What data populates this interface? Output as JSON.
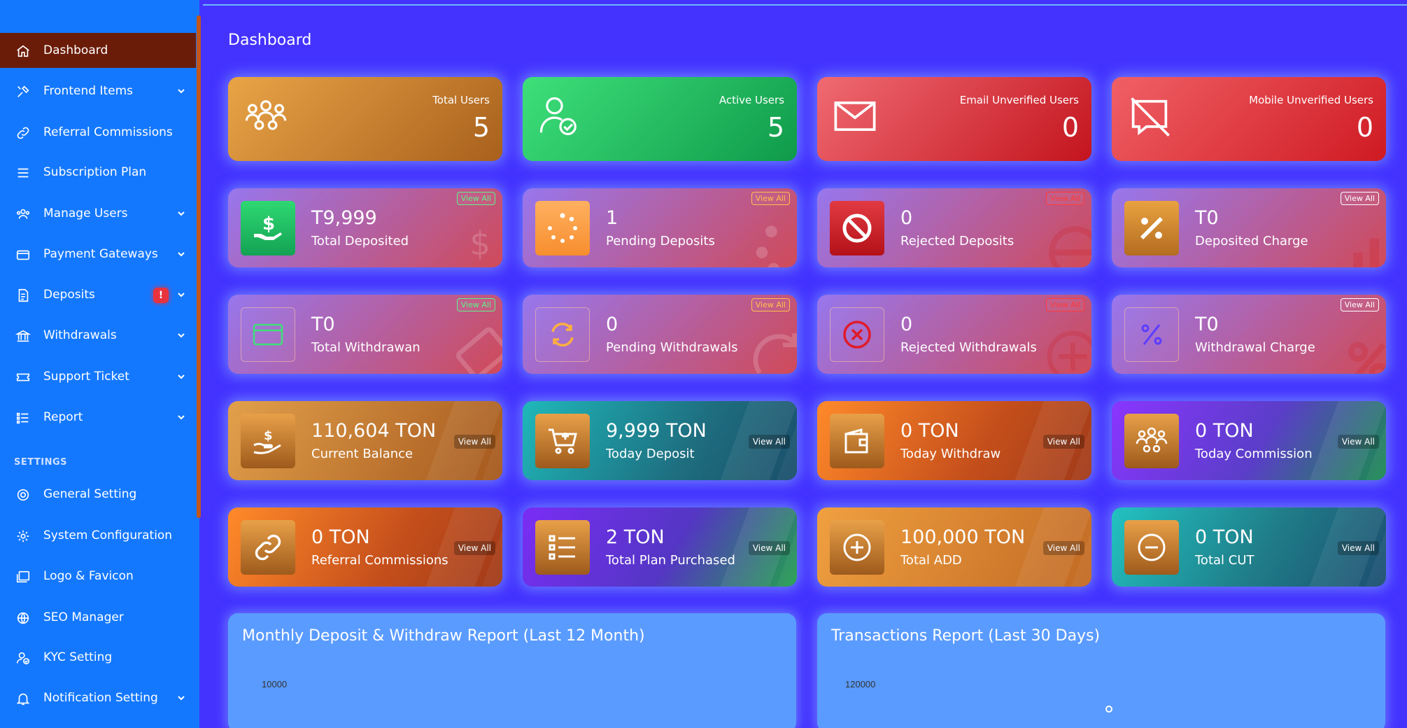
{
  "sidebar": {
    "items": [
      {
        "label": "Dashboard",
        "icon": "home-icon",
        "active": true,
        "chevron": false
      },
      {
        "label": "Frontend Items",
        "icon": "tools-icon",
        "chevron": true
      },
      {
        "label": "Referral Commissions",
        "icon": "link-icon",
        "chevron": false
      },
      {
        "label": "Subscription Plan",
        "icon": "menu-icon",
        "chevron": false
      },
      {
        "label": "Manage Users",
        "icon": "users-icon",
        "chevron": true
      },
      {
        "label": "Payment Gateways",
        "icon": "card-icon",
        "chevron": true
      },
      {
        "label": "Deposits",
        "icon": "receipt-icon",
        "chevron": true,
        "badge": "!"
      },
      {
        "label": "Withdrawals",
        "icon": "bank-icon",
        "chevron": true
      },
      {
        "label": "Support Ticket",
        "icon": "ticket-icon",
        "chevron": true
      },
      {
        "label": "Report",
        "icon": "list-icon",
        "chevron": true
      }
    ],
    "settings_header": "SETTINGS",
    "settings_items": [
      {
        "label": "General Setting",
        "icon": "lifebuoy-icon",
        "chevron": false
      },
      {
        "label": "System Configuration",
        "icon": "gear-icon",
        "chevron": false
      },
      {
        "label": "Logo & Favicon",
        "icon": "images-icon",
        "chevron": false
      },
      {
        "label": "SEO Manager",
        "icon": "globe-icon",
        "chevron": false
      },
      {
        "label": "KYC Setting",
        "icon": "user-check-icon",
        "chevron": false
      },
      {
        "label": "Notification Setting",
        "icon": "bell-icon",
        "chevron": true
      }
    ]
  },
  "page_title": "Dashboard",
  "top_cards": [
    {
      "label": "Total Users",
      "value": "5",
      "icon": "users-group-icon"
    },
    {
      "label": "Active Users",
      "value": "5",
      "icon": "user-check-icon"
    },
    {
      "label": "Email Unverified Users",
      "value": "0",
      "icon": "envelope-icon"
    },
    {
      "label": "Mobile Unverified Users",
      "value": "0",
      "icon": "message-slash-icon"
    }
  ],
  "deposit_cards": [
    {
      "value": "T9,999",
      "label": "Total Deposited",
      "link": "View All",
      "icon": "hand-dollar-icon"
    },
    {
      "value": "1",
      "label": "Pending Deposits",
      "link": "View All",
      "icon": "spinner-icon"
    },
    {
      "value": "0",
      "label": "Rejected Deposits",
      "link": "View All",
      "icon": "ban-icon"
    },
    {
      "value": "T0",
      "label": "Deposited Charge",
      "link": "View All",
      "icon": "percent-icon"
    }
  ],
  "withdraw_cards": [
    {
      "value": "T0",
      "label": "Total Withdrawan",
      "link": "View All",
      "icon": "credit-card-icon"
    },
    {
      "value": "0",
      "label": "Pending Withdrawals",
      "link": "View All",
      "icon": "sync-icon"
    },
    {
      "value": "0",
      "label": "Rejected Withdrawals",
      "link": "View All",
      "icon": "x-circle-icon"
    },
    {
      "value": "T0",
      "label": "Withdrawal Charge",
      "link": "View All",
      "icon": "percent-icon"
    }
  ],
  "balance_cards": [
    {
      "value": "110,604 TON",
      "label": "Current Balance",
      "link": "View All",
      "icon": "hand-coin-icon"
    },
    {
      "value": "9,999 TON",
      "label": "Today Deposit",
      "link": "View All",
      "icon": "cart-plus-icon"
    },
    {
      "value": "0 TON",
      "label": "Today Withdraw",
      "link": "View All",
      "icon": "wallet-icon"
    },
    {
      "value": "0 TON",
      "label": "Today Commission",
      "link": "View All",
      "icon": "users-group-icon"
    }
  ],
  "total_cards": [
    {
      "value": "0 TON",
      "label": "Referral Commissions",
      "link": "View All",
      "icon": "link-icon"
    },
    {
      "value": "2 TON",
      "label": "Total Plan Purchased",
      "link": "View All",
      "icon": "list-check-icon"
    },
    {
      "value": "100,000 TON",
      "label": "Total ADD",
      "link": "View All",
      "icon": "plus-circle-icon"
    },
    {
      "value": "0 TON",
      "label": "Total CUT",
      "link": "View All",
      "icon": "minus-circle-icon"
    }
  ],
  "panels": [
    {
      "title": "Monthly Deposit & Withdraw Report (Last 12 Month)",
      "ytick": "10000"
    },
    {
      "title": "Transactions Report (Last 30 Days)",
      "ytick": "120000"
    }
  ]
}
